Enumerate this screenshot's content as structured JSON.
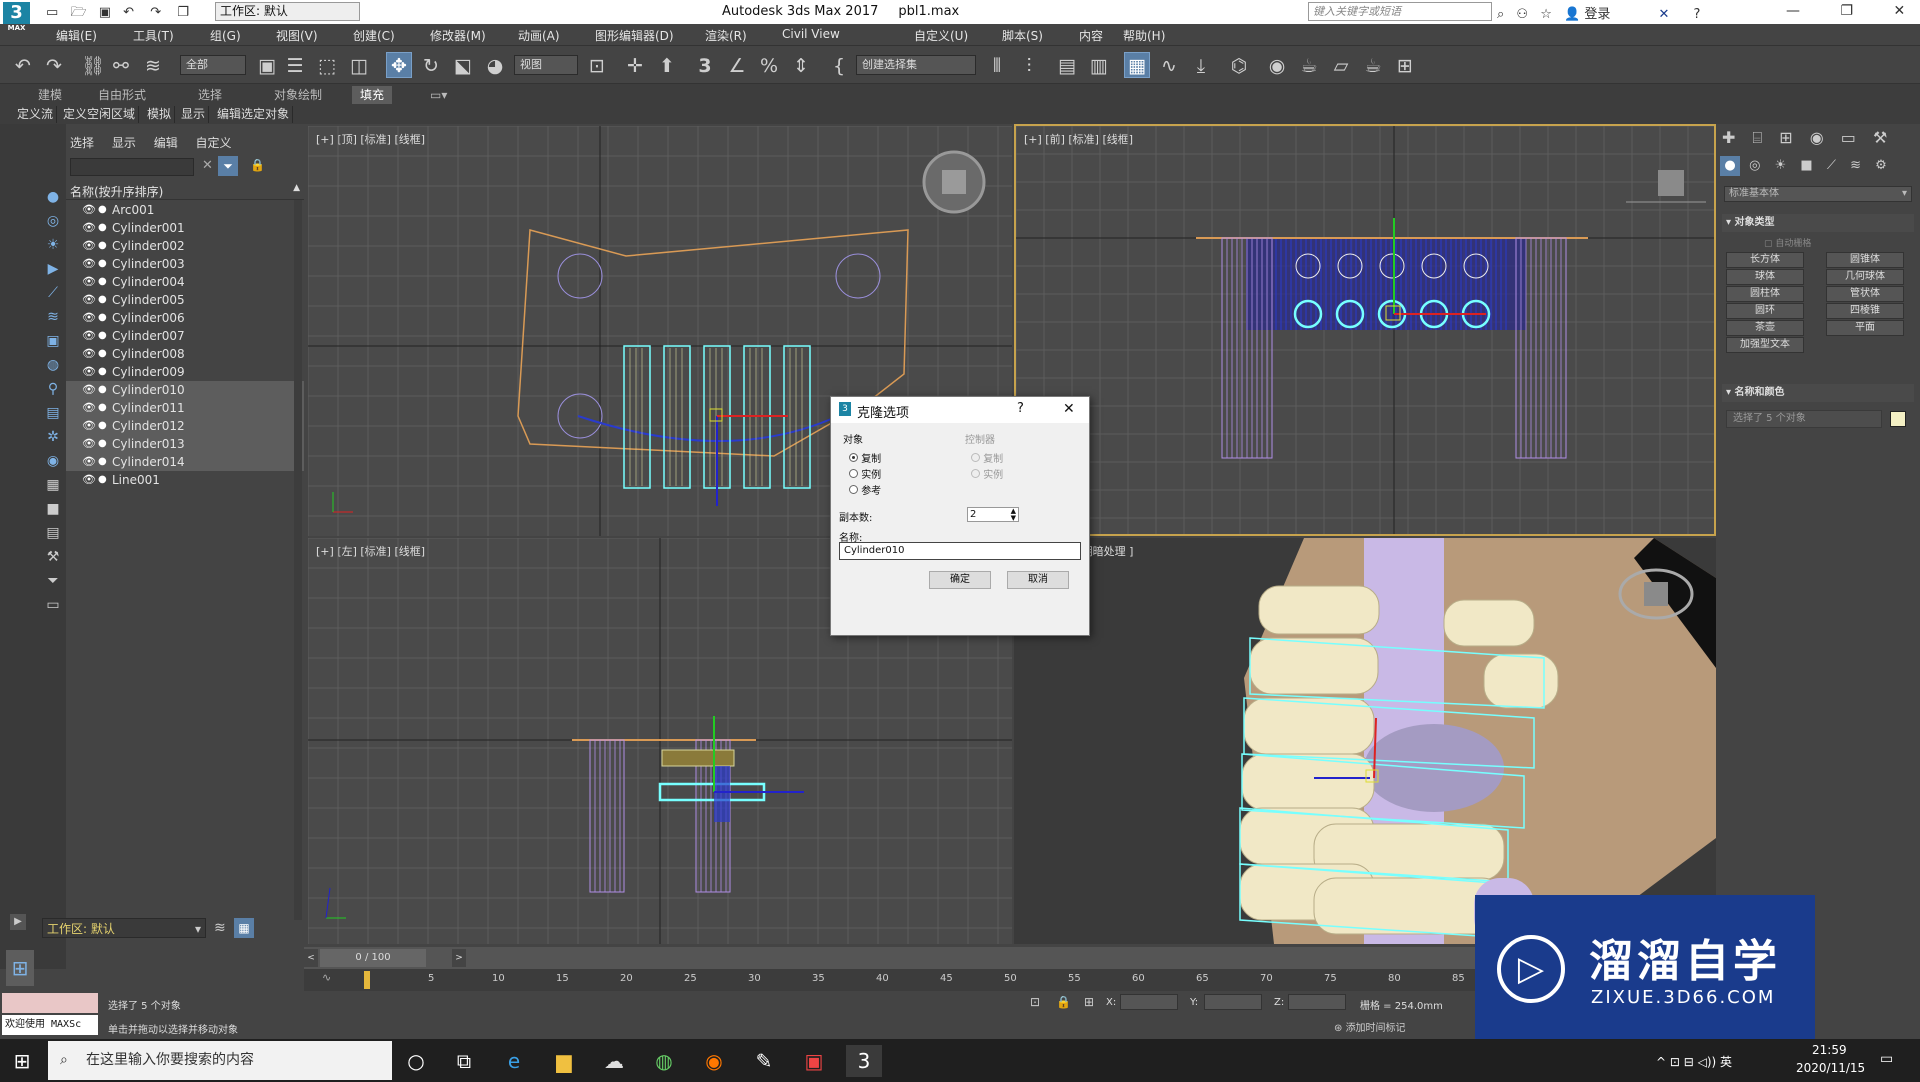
{
  "app": {
    "title": "Autodesk 3ds Max 2017",
    "file": "pbl1.max",
    "logo": "3",
    "logo_sub": "MAX",
    "workspace": "工作区: 默认",
    "search_placeholder": "键入关键字或短语",
    "login": "登录"
  },
  "menu": [
    "编辑(E)",
    "工具(T)",
    "组(G)",
    "视图(V)",
    "创建(C)",
    "修改器(M)",
    "动画(A)",
    "图形编辑器(D)",
    "渲染(R)",
    "Civil View",
    "自定义(U)",
    "脚本(S)",
    "内容",
    "帮助(H)"
  ],
  "toolbar": {
    "filter": "全部",
    "refcoord": "视图",
    "selset": "创建选择集",
    "snap_label": "3"
  },
  "ribbon": {
    "tabs": [
      "建模",
      "自由形式",
      "选择",
      "对象绘制",
      "填充"
    ],
    "active": "填充",
    "subtabs": [
      "定义流",
      "定义空闲区域",
      "模拟",
      "显示",
      "编辑选定对象"
    ]
  },
  "scene_explorer": {
    "menu": [
      "选择",
      "显示",
      "编辑",
      "自定义"
    ],
    "header": "名称(按升序排序)",
    "items": [
      {
        "name": "Arc001",
        "sel": false
      },
      {
        "name": "Cylinder001",
        "sel": false
      },
      {
        "name": "Cylinder002",
        "sel": false
      },
      {
        "name": "Cylinder003",
        "sel": false
      },
      {
        "name": "Cylinder004",
        "sel": false
      },
      {
        "name": "Cylinder005",
        "sel": false
      },
      {
        "name": "Cylinder006",
        "sel": false
      },
      {
        "name": "Cylinder007",
        "sel": false
      },
      {
        "name": "Cylinder008",
        "sel": false
      },
      {
        "name": "Cylinder009",
        "sel": false
      },
      {
        "name": "Cylinder010",
        "sel": true
      },
      {
        "name": "Cylinder011",
        "sel": true
      },
      {
        "name": "Cylinder012",
        "sel": true
      },
      {
        "name": "Cylinder013",
        "sel": true
      },
      {
        "name": "Cylinder014",
        "sel": true
      },
      {
        "name": "Line001",
        "sel": false
      }
    ],
    "workspace": "工作区: 默认"
  },
  "viewports": {
    "top": "[+] [顶] [标准] [线框]",
    "front": "[+] [前] [标准] [线框]",
    "left": "[+] [左] [标准] [线框]",
    "persp": "标准 ] [默认明暗处理 ]"
  },
  "dialog": {
    "title": "克隆选项",
    "help": "?",
    "close": "✕",
    "object_label": "对象",
    "options": [
      "复制",
      "实例",
      "参考"
    ],
    "controller_label": "控制器",
    "ctrl_options": [
      "复制",
      "实例"
    ],
    "copies_label": "副本数:",
    "copies": "2",
    "name_label": "名称:",
    "name_value": "Cylinder010",
    "ok": "确定",
    "cancel": "取消"
  },
  "cmd": {
    "dropdown": "标准基本体",
    "rollout_objtype": "对象类型",
    "autogrid": "自动栅格",
    "buttons": [
      "长方体",
      "圆锥体",
      "球体",
      "几何球体",
      "圆柱体",
      "管状体",
      "圆环",
      "四棱锥",
      "茶壶",
      "平面",
      "加强型文本"
    ],
    "rollout_name": "名称和颜色",
    "name_value": "选择了 5 个对象"
  },
  "timeline": {
    "frame": "0 / 100",
    "ticks": [
      "5",
      "10",
      "15",
      "20",
      "25",
      "30",
      "35",
      "40",
      "45",
      "50",
      "55",
      "60",
      "65",
      "70",
      "75",
      "80",
      "85"
    ]
  },
  "status": {
    "maxscript": "欢迎使用 MAXSc",
    "selected": "选择了 5 个对象",
    "hint": "单击并拖动以选择并移动对象",
    "x_label": "X:",
    "y_label": "Y:",
    "z_label": "Z:",
    "grid": "栅格 = 254.0mm",
    "addtime": "添加时间标记"
  },
  "taskbar": {
    "search": "在这里输入你要搜索的内容",
    "time": "21:59",
    "date": "2020/11/15",
    "ime": "英"
  },
  "watermark": {
    "title": "溜溜自学",
    "url": "ZIXUE.3D66.COM"
  }
}
